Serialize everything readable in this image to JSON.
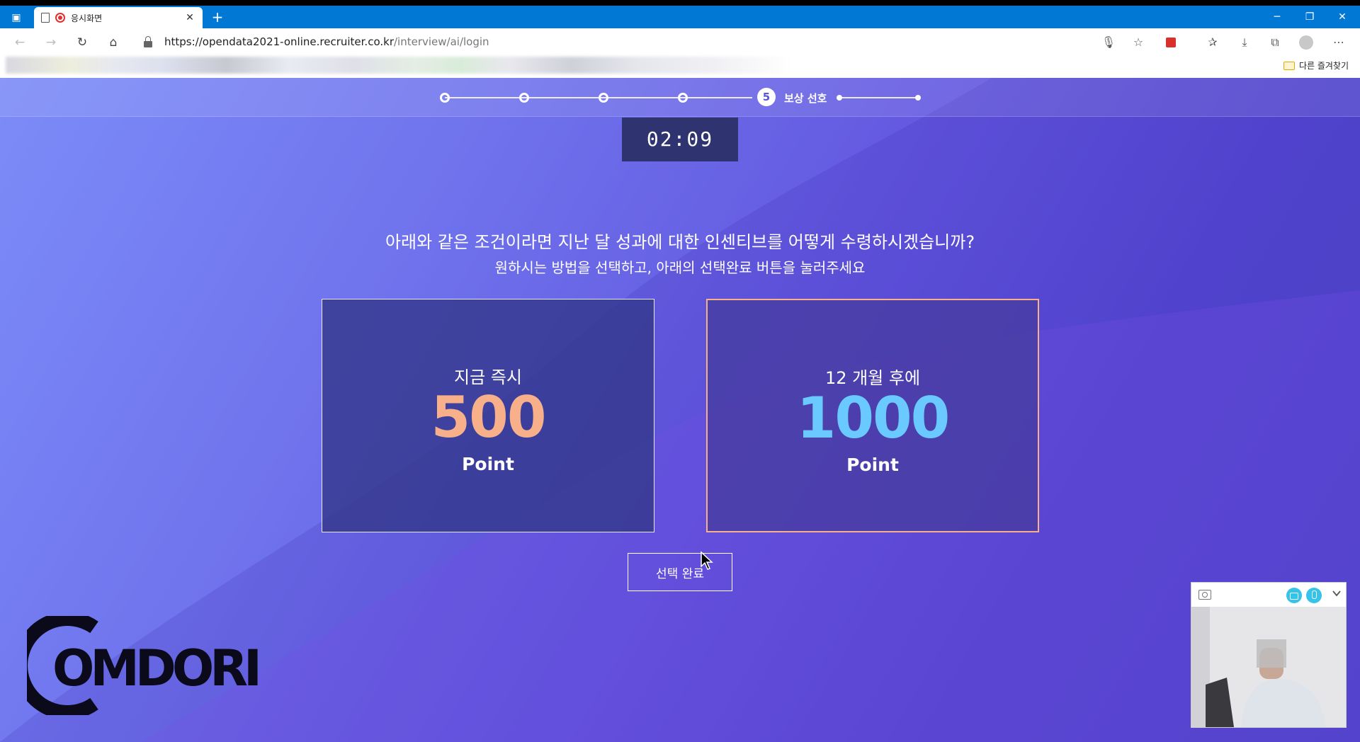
{
  "browser": {
    "tab_title": "응시화면",
    "url_host": "https://opendata2021-online.recruiter.co.kr",
    "url_path": "/interview/ai/login",
    "other_favorites": "다른 즐겨찾기"
  },
  "steps": {
    "current_number": "5",
    "current_label": "보상 선호"
  },
  "timer": "02:09",
  "question": {
    "title": "아래와 같은 조건이라면 지난 달 성과에 대한 인센티브를 어떻게 수령하시겠습니까?",
    "subtitle": "원하시는 방법을 선택하고, 아래의 선택완료 버튼을 눌러주세요"
  },
  "options": [
    {
      "when": "지금 즉시",
      "amount": "500",
      "unit": "Point",
      "color": "#f7b08a",
      "selected": false
    },
    {
      "when": "12 개월 후에",
      "amount": "1000",
      "unit": "Point",
      "color": "#6ac9ff",
      "selected": true
    }
  ],
  "confirm_button": "선택 완료",
  "watermark": "COMDORI"
}
